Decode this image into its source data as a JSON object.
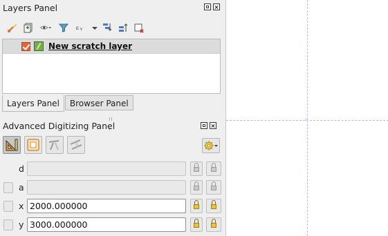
{
  "layers_panel": {
    "title": "Layers Panel",
    "toolbar_icons": [
      "style-brush-icon",
      "add-group-icon",
      "eye-visibility-icon",
      "chevron-down-icon",
      "filter-icon",
      "expression-filter-icon",
      "chevron-down-icon",
      "expand-all-icon",
      "collapse-all-icon",
      "remove-layer-icon"
    ],
    "layers": [
      {
        "name": "New scratch layer",
        "checked": true,
        "icon": "line-layer-icon"
      }
    ],
    "tabs": [
      {
        "label": "Layers Panel",
        "active": true
      },
      {
        "label": "Browser Panel",
        "active": false
      }
    ]
  },
  "advanced_digitizing": {
    "title": "Advanced Digitizing Panel",
    "tool_icons": [
      "cad-enable-icon",
      "construction-mode-icon",
      "parallel-icon",
      "perpendicular-icon"
    ],
    "settings_icon": "gear-icon",
    "fields": [
      {
        "label": "d",
        "value": "",
        "enabled": false,
        "locked": false
      },
      {
        "label": "a",
        "value": "",
        "enabled": false,
        "locked": false
      },
      {
        "label": "x",
        "value": "2000.000000",
        "enabled": true,
        "locked": true
      },
      {
        "label": "y",
        "value": "3000.000000",
        "enabled": true,
        "locked": true
      }
    ]
  },
  "colors": {
    "accent_checkbox": "#e7643a",
    "guide_line": "#b6b8e6",
    "lock_active": "#e9c33e"
  }
}
